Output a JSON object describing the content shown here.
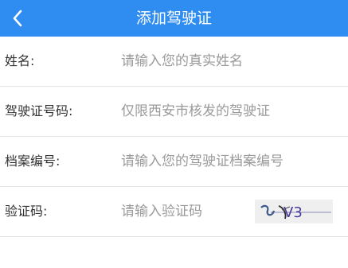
{
  "header": {
    "title": "添加驾驶证",
    "back_icon": "chevron-left-icon",
    "background": "#2f8cf0"
  },
  "form": {
    "fields": [
      {
        "label": "姓名:",
        "placeholder": "请输入您的真实姓名",
        "value": ""
      },
      {
        "label": "驾驶证号码:",
        "placeholder": "仅限西安市核发的驾驶证",
        "value": ""
      },
      {
        "label": "档案编号:",
        "placeholder": "请输入您的驾驶证档案编号",
        "value": ""
      },
      {
        "label": "验证码:",
        "placeholder": "请输入验证码",
        "value": ""
      }
    ],
    "captcha": {
      "text": "V3"
    }
  }
}
